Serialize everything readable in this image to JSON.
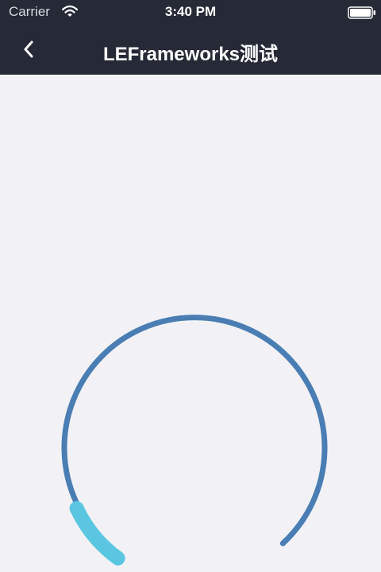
{
  "status_bar": {
    "carrier": "Carrier",
    "time": "3:40 PM",
    "wifi_icon": "wifi-icon",
    "battery_icon": "battery-icon"
  },
  "nav_bar": {
    "back_icon": "chevron-left-icon",
    "title": "LEFrameworks测试",
    "background_color": "#252a36"
  },
  "gauge": {
    "progress": 0.1,
    "track_color": "#4a7eb3",
    "progress_color": "#5bc6e0"
  }
}
